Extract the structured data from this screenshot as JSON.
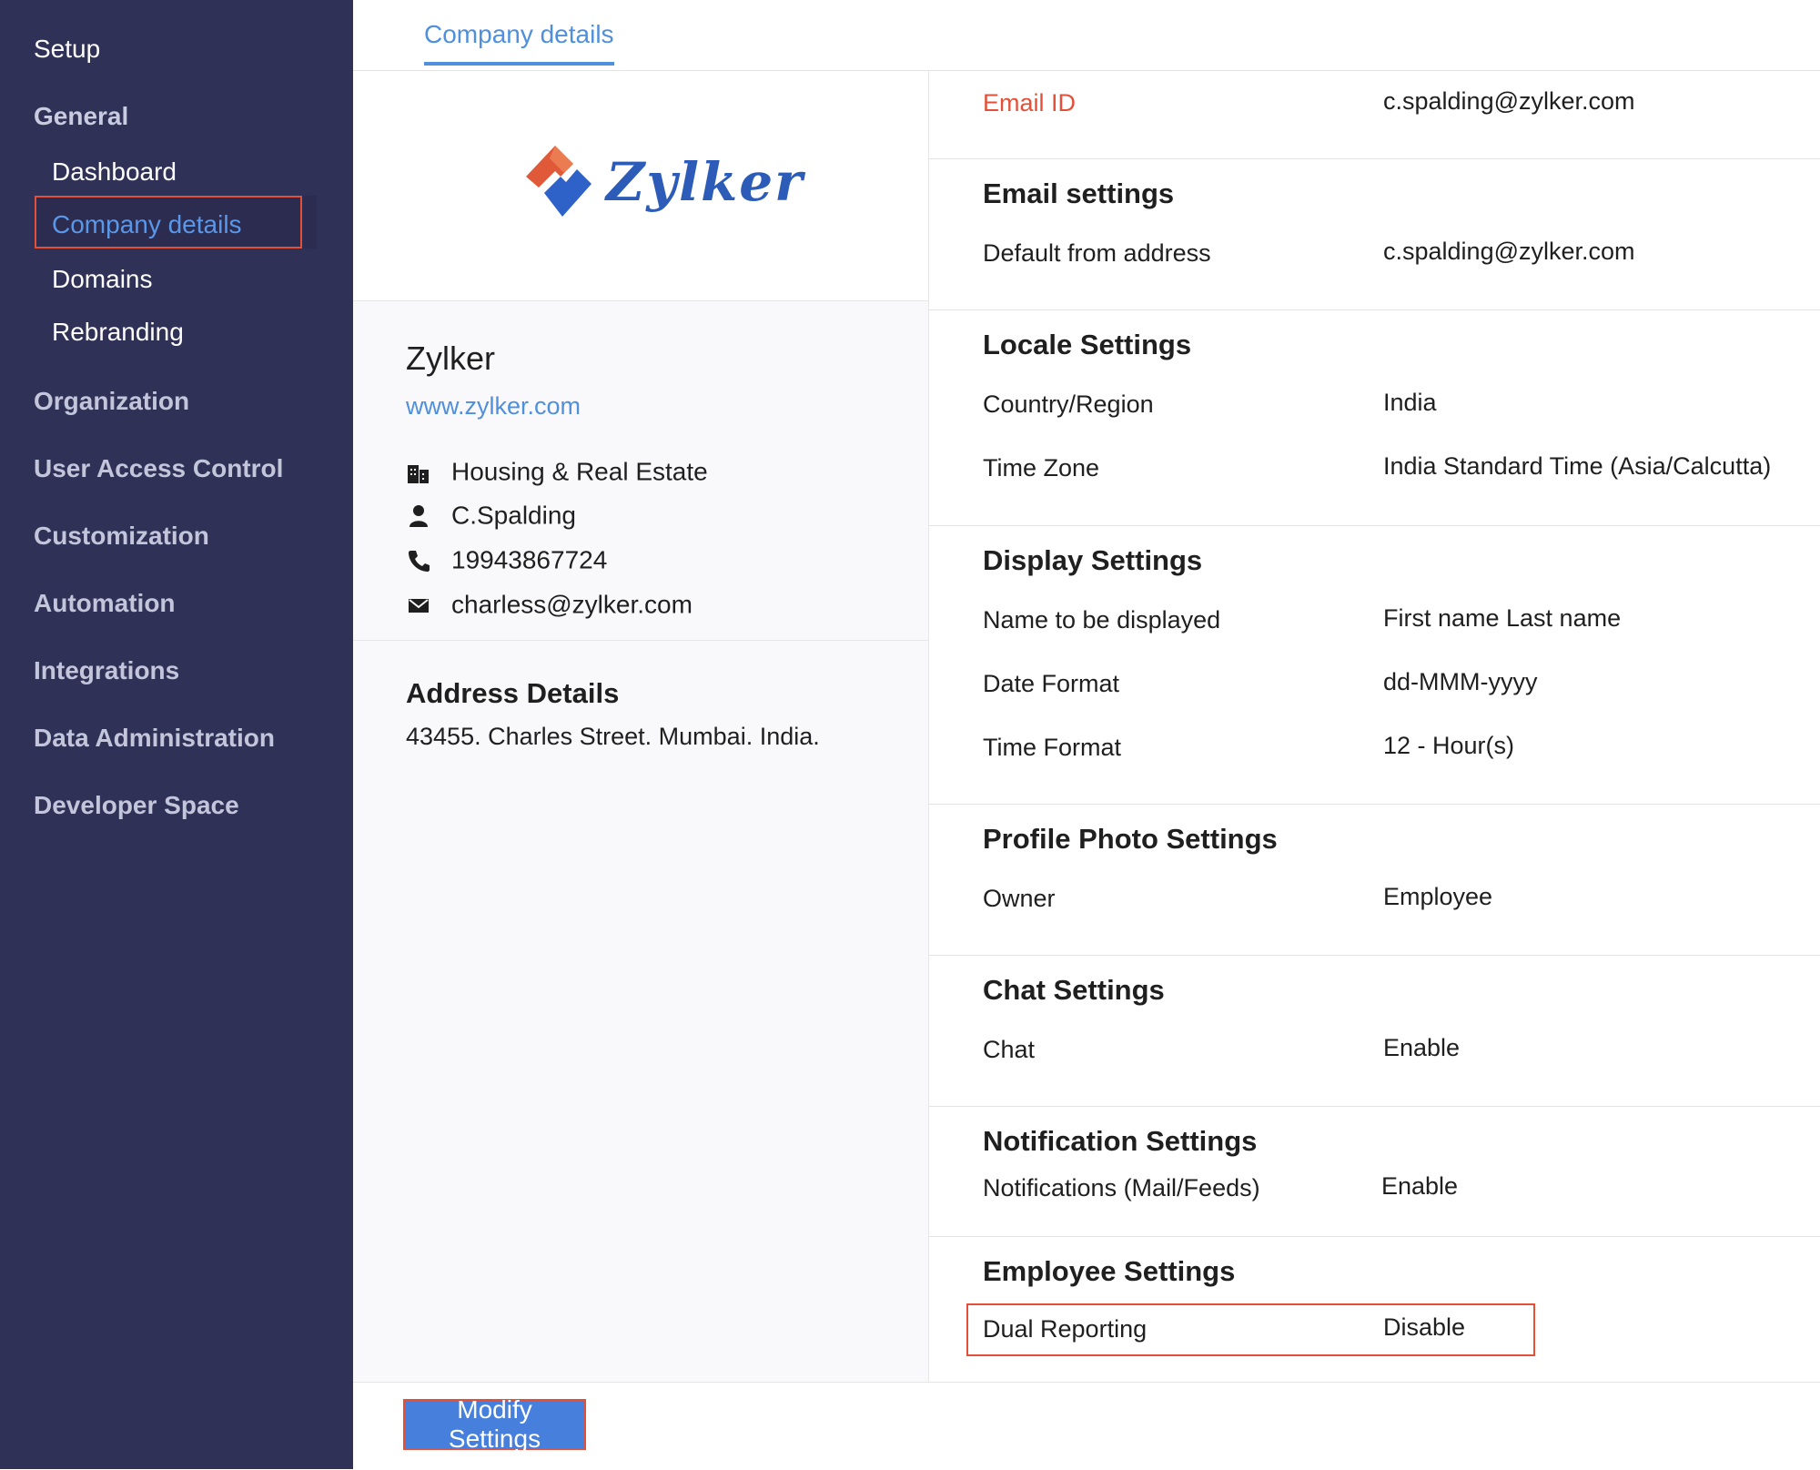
{
  "sidebar": {
    "title": "Setup",
    "groups": [
      {
        "label": "General",
        "items": [
          "Dashboard",
          "Company details",
          "Domains",
          "Rebranding"
        ],
        "selected": "Company details"
      },
      {
        "label": "Organization"
      },
      {
        "label": "User Access Control"
      },
      {
        "label": "Customization"
      },
      {
        "label": "Automation"
      },
      {
        "label": "Integrations"
      },
      {
        "label": "Data Administration"
      },
      {
        "label": "Developer Space"
      }
    ]
  },
  "tabs": [
    {
      "label": "Company details",
      "active": true
    }
  ],
  "company": {
    "logo_text": "Zylker",
    "name": "Zylker",
    "website": "www.zylker.com",
    "industry": "Housing & Real Estate",
    "contact": "C.Spalding",
    "phone": "19943867724",
    "email": "charless@zylker.com",
    "address_title": "Address Details",
    "address": "43455. Charles Street. Mumbai. India.",
    "icons": {
      "industry": "building-icon",
      "contact": "person-icon",
      "phone": "phone-icon",
      "email": "envelope-icon"
    }
  },
  "settings": {
    "email_id": {
      "label": "Email ID",
      "value": "c.spalding@zylker.com"
    },
    "email_settings": {
      "title": "Email settings",
      "rows": [
        {
          "label": "Default from address",
          "value": "c.spalding@zylker.com"
        }
      ]
    },
    "locale_settings": {
      "title": "Locale Settings",
      "rows": [
        {
          "label": "Country/Region",
          "value": "India"
        },
        {
          "label": "Time Zone",
          "value": "India Standard Time (Asia/Calcutta)"
        }
      ]
    },
    "display_settings": {
      "title": "Display Settings",
      "rows": [
        {
          "label": "Name to be displayed",
          "value": "First name Last name"
        },
        {
          "label": "Date Format",
          "value": "dd-MMM-yyyy"
        },
        {
          "label": "Time Format",
          "value": "12 - Hour(s)"
        }
      ]
    },
    "profile_photo_settings": {
      "title": "Profile Photo Settings",
      "rows": [
        {
          "label": "Owner",
          "value": "Employee"
        }
      ]
    },
    "chat_settings": {
      "title": "Chat Settings",
      "rows": [
        {
          "label": "Chat",
          "value": "Enable"
        }
      ]
    },
    "notification_settings": {
      "title": "Notification Settings",
      "rows": [
        {
          "label": "Notifications (Mail/Feeds)",
          "value": "Enable"
        }
      ]
    },
    "employee_settings": {
      "title": "Employee Settings",
      "rows": [
        {
          "label": "Dual Reporting",
          "value": "Disable"
        }
      ]
    }
  },
  "footer": {
    "modify_button": "Modify Settings"
  },
  "colors": {
    "sidebar_bg": "#303157",
    "accent_blue": "#4f8fdc",
    "highlight_red": "#e2503a",
    "button_blue": "#4680dc"
  }
}
